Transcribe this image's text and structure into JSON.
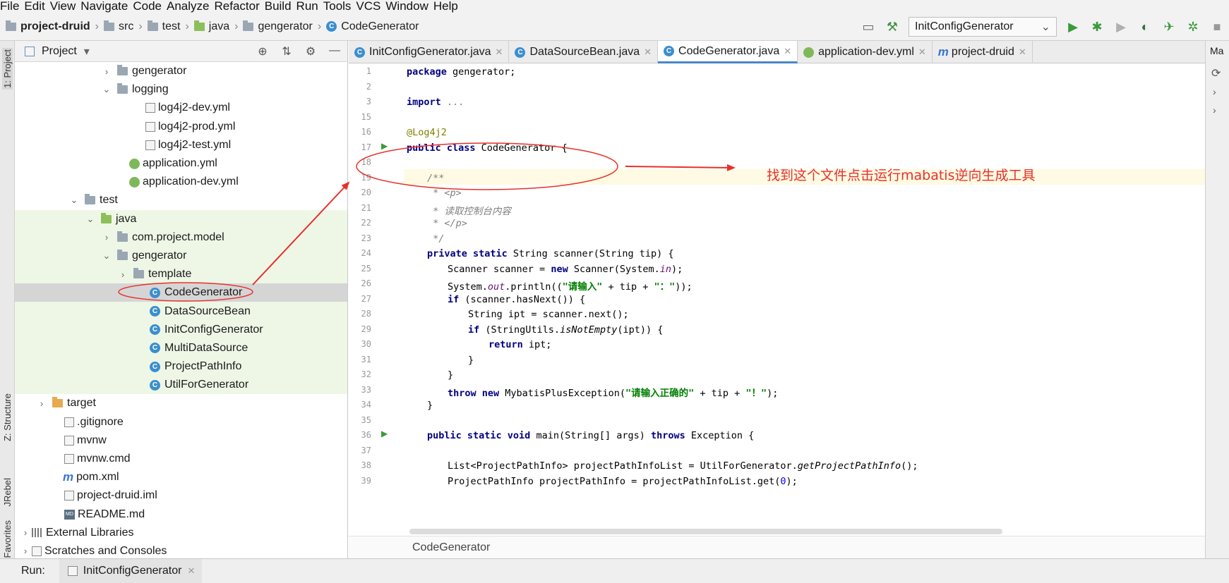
{
  "menu": [
    "File",
    "Edit",
    "View",
    "Navigate",
    "Code",
    "Analyze",
    "Refactor",
    "Build",
    "Run",
    "Tools",
    "VCS",
    "Window",
    "Help"
  ],
  "breadcrumb": {
    "project": "project-druid",
    "items": [
      "src",
      "test",
      "java",
      "gengerator",
      "CodeGenerator"
    ]
  },
  "toolbar": {
    "run_config": "InitConfigGenerator"
  },
  "left_strip": {
    "project_tab": "1: Project",
    "structure_tab": "Z: Structure",
    "jrebel_tab": "JRebel",
    "favorites_tab": "Favorites"
  },
  "project_panel": {
    "title": "Project",
    "tree": [
      {
        "label": "gengerator",
        "indent": 5,
        "arrow": "›",
        "icon": "folder",
        "bg": ""
      },
      {
        "label": "logging",
        "indent": 5,
        "arrow": "⌄",
        "icon": "folder",
        "bg": ""
      },
      {
        "label": "log4j2-dev.yml",
        "indent": 7,
        "arrow": "",
        "icon": "file",
        "bg": ""
      },
      {
        "label": "log4j2-prod.yml",
        "indent": 7,
        "arrow": "",
        "icon": "file",
        "bg": ""
      },
      {
        "label": "log4j2-test.yml",
        "indent": 7,
        "arrow": "",
        "icon": "file",
        "bg": ""
      },
      {
        "label": "application.yml",
        "indent": 6,
        "arrow": "",
        "icon": "yml",
        "bg": ""
      },
      {
        "label": "application-dev.yml",
        "indent": 6,
        "arrow": "",
        "icon": "yml",
        "bg": ""
      },
      {
        "label": "test",
        "indent": 3,
        "arrow": "⌄",
        "icon": "folder",
        "bg": ""
      },
      {
        "label": "java",
        "indent": 4,
        "arrow": "⌄",
        "icon": "folder-green",
        "bg": "green"
      },
      {
        "label": "com.project.model",
        "indent": 5,
        "arrow": "›",
        "icon": "folder",
        "bg": "green"
      },
      {
        "label": "gengerator",
        "indent": 5,
        "arrow": "⌄",
        "icon": "folder",
        "bg": "green"
      },
      {
        "label": "template",
        "indent": 6,
        "arrow": "›",
        "icon": "folder",
        "bg": "green"
      },
      {
        "label": "CodeGenerator",
        "indent": 7,
        "arrow": "",
        "icon": "class",
        "bg": "selected"
      },
      {
        "label": "DataSourceBean",
        "indent": 7,
        "arrow": "",
        "icon": "class",
        "bg": "green"
      },
      {
        "label": "InitConfigGenerator",
        "indent": 7,
        "arrow": "",
        "icon": "class",
        "bg": "green"
      },
      {
        "label": "MultiDataSource",
        "indent": 7,
        "arrow": "",
        "icon": "class",
        "bg": "green"
      },
      {
        "label": "ProjectPathInfo",
        "indent": 7,
        "arrow": "",
        "icon": "class",
        "bg": "green"
      },
      {
        "label": "UtilForGenerator",
        "indent": 7,
        "arrow": "",
        "icon": "class",
        "bg": "green"
      },
      {
        "label": "target",
        "indent": 1,
        "arrow": "›",
        "icon": "folder-orange",
        "bg": ""
      },
      {
        "label": ".gitignore",
        "indent": 2,
        "arrow": "",
        "icon": "file",
        "bg": ""
      },
      {
        "label": "mvnw",
        "indent": 2,
        "arrow": "",
        "icon": "file",
        "bg": ""
      },
      {
        "label": "mvnw.cmd",
        "indent": 2,
        "arrow": "",
        "icon": "file",
        "bg": ""
      },
      {
        "label": "pom.xml",
        "indent": 2,
        "arrow": "",
        "icon": "maven",
        "bg": ""
      },
      {
        "label": "project-druid.iml",
        "indent": 2,
        "arrow": "",
        "icon": "file",
        "bg": ""
      },
      {
        "label": "README.md",
        "indent": 2,
        "arrow": "",
        "icon": "md",
        "bg": ""
      },
      {
        "label": "External Libraries",
        "indent": 0,
        "arrow": "›",
        "icon": "lib",
        "bg": ""
      },
      {
        "label": "Scratches and Consoles",
        "indent": 0,
        "arrow": "›",
        "icon": "scratch",
        "bg": ""
      }
    ]
  },
  "tabs": [
    {
      "label": "InitConfigGenerator.java",
      "icon": "class",
      "active": false
    },
    {
      "label": "DataSourceBean.java",
      "icon": "class",
      "active": false
    },
    {
      "label": "CodeGenerator.java",
      "icon": "class",
      "active": true
    },
    {
      "label": "application-dev.yml",
      "icon": "yml",
      "active": false
    },
    {
      "label": "project-druid",
      "icon": "maven",
      "active": false
    }
  ],
  "code_lines": [
    {
      "n": "1",
      "html": "<span class=\"kw\">package</span> gengerator;",
      "indent": 0
    },
    {
      "n": "2",
      "html": "",
      "indent": 0
    },
    {
      "n": "3",
      "html": "<span class=\"kw\">import</span> <span style=\"color:#808080\">...</span>",
      "indent": 0
    },
    {
      "n": "15",
      "html": "",
      "indent": 0
    },
    {
      "n": "16",
      "html": "<span style=\"color:#808000\">@Log4j2</span>",
      "indent": 0
    },
    {
      "n": "17",
      "html": "<span class=\"kw\">public class</span> CodeGenerator {",
      "indent": 0
    },
    {
      "n": "18",
      "html": "",
      "indent": 0
    },
    {
      "n": "19",
      "html": "<span class=\"cm\">/**</span>",
      "indent": 1
    },
    {
      "n": "20",
      "html": "<span class=\"cm\"> * &lt;p&gt;</span>",
      "indent": 1
    },
    {
      "n": "21",
      "html": "<span class=\"cm\"> * 读取控制台内容</span>",
      "indent": 1
    },
    {
      "n": "22",
      "html": "<span class=\"cm\"> * &lt;/p&gt;</span>",
      "indent": 1
    },
    {
      "n": "23",
      "html": "<span class=\"cm\"> */</span>",
      "indent": 1
    },
    {
      "n": "24",
      "html": "<span class=\"kw\">private static</span> String scanner(String tip) {",
      "indent": 1
    },
    {
      "n": "25",
      "html": "Scanner scanner = <span class=\"kw\">new</span> Scanner(System.<span class=\"it\" style=\"color:#660e7a\">in</span>);",
      "indent": 2
    },
    {
      "n": "26",
      "html": "System.<span class=\"it\" style=\"color:#660e7a\">out</span>.println((<span class=\"str\">\"请输入\"</span> + tip + <span class=\"str\">\"：\"</span>));",
      "indent": 2
    },
    {
      "n": "27",
      "html": "<span class=\"kw\">if</span> (scanner.hasNext()) {",
      "indent": 2
    },
    {
      "n": "28",
      "html": "String ipt = scanner.next();",
      "indent": 3
    },
    {
      "n": "29",
      "html": "<span class=\"kw\">if</span> (StringUtils.<span class=\"it\">isNotEmpty</span>(ipt)) {",
      "indent": 3
    },
    {
      "n": "30",
      "html": "<span class=\"kw\">return</span> ipt;",
      "indent": 4
    },
    {
      "n": "31",
      "html": "}",
      "indent": 3
    },
    {
      "n": "32",
      "html": "}",
      "indent": 2
    },
    {
      "n": "33",
      "html": "<span class=\"kw\">throw new</span> MybatisPlusException(<span class=\"str\">\"请输入正确的\"</span> + tip + <span class=\"str\">\"！\"</span>);",
      "indent": 2
    },
    {
      "n": "34",
      "html": "}",
      "indent": 1
    },
    {
      "n": "35",
      "html": "",
      "indent": 0
    },
    {
      "n": "36",
      "html": "<span class=\"kw\">public static void</span> main(String[] args) <span class=\"kw\">throws</span> Exception {",
      "indent": 1
    },
    {
      "n": "37",
      "html": "",
      "indent": 0
    },
    {
      "n": "38",
      "html": "List&lt;ProjectPathInfo&gt; projectPathInfoList = UtilForGenerator.<span class=\"it\">getProjectPathInfo</span>();",
      "indent": 2
    },
    {
      "n": "39",
      "html": "ProjectPathInfo projectPathInfo = projectPathInfoList.get(<span style=\"color:#0000ff\">0</span>);",
      "indent": 2
    }
  ],
  "editor_footer": "CodeGenerator",
  "right_strip": {
    "label": "Ma"
  },
  "run_bar": {
    "label": "Run:",
    "config": "InitConfigGenerator"
  },
  "annotation": {
    "text": "找到这个文件点击运行mabatis逆向生成工具",
    "color": "#e8302a"
  }
}
